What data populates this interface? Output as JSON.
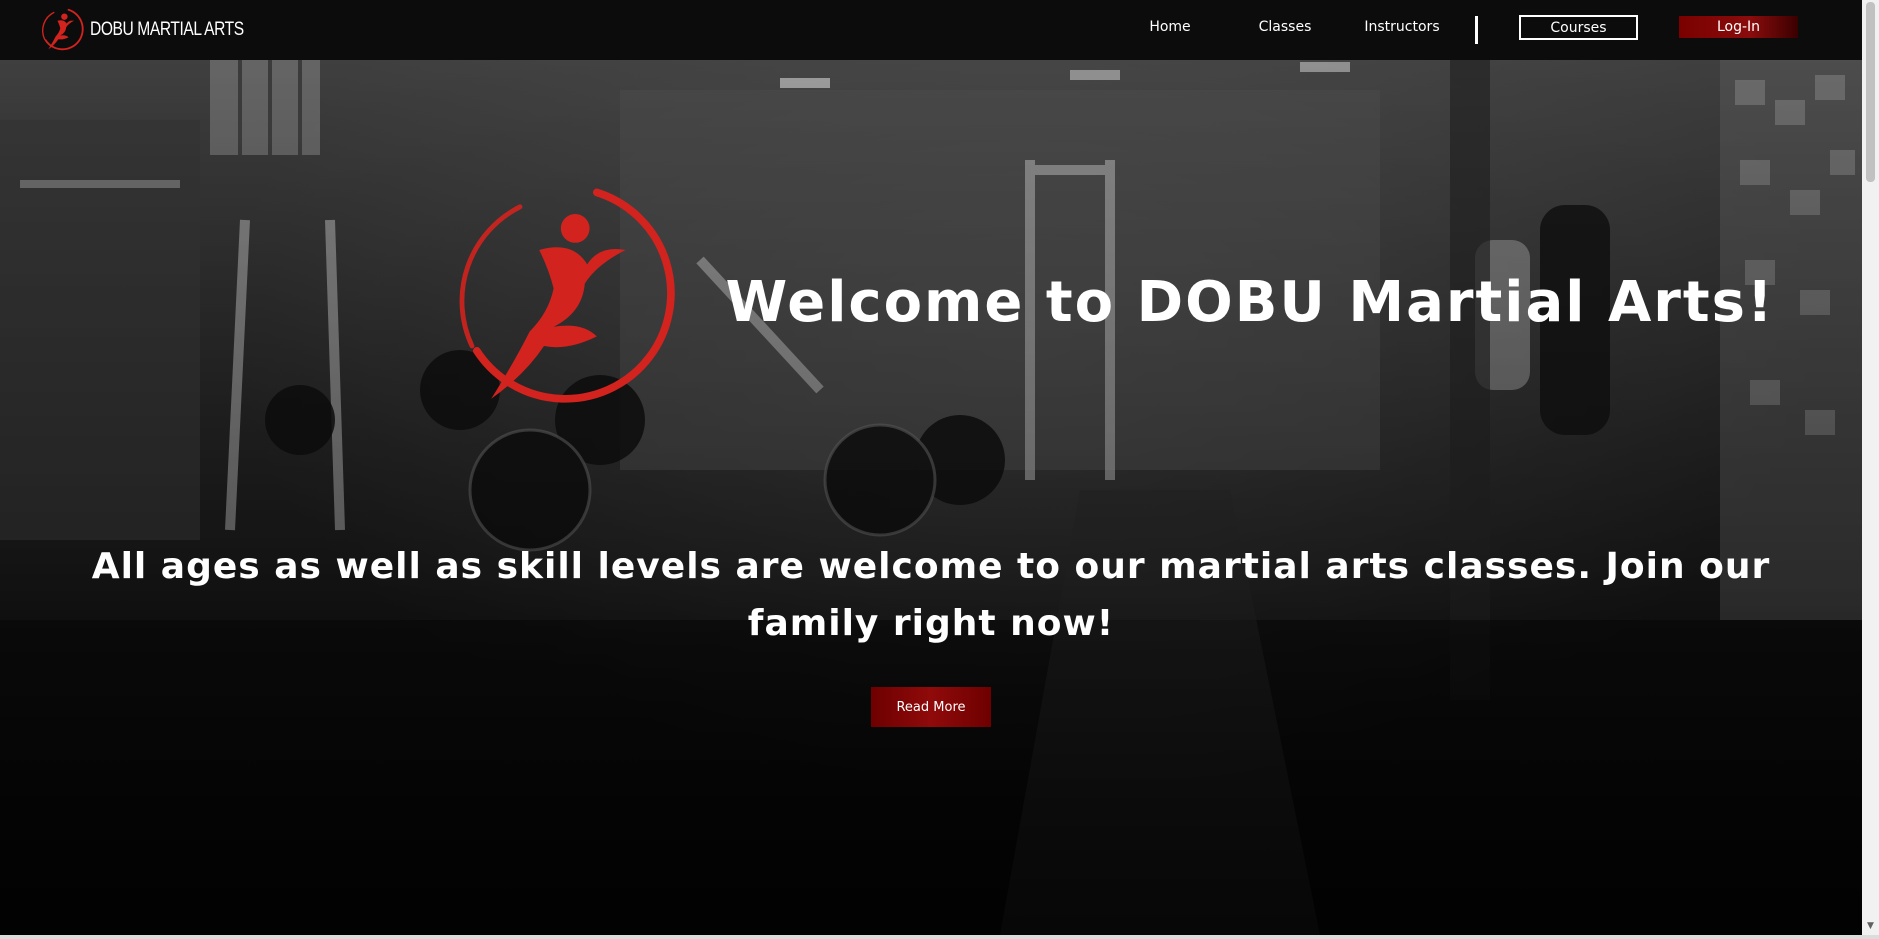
{
  "header": {
    "brand_name": "DOBU MARTIAL ARTS",
    "nav": {
      "home": "Home",
      "classes": "Classes",
      "instructors": "Instructors"
    },
    "courses_button": "Courses",
    "login_button": "Log-In"
  },
  "hero": {
    "title": "Welcome to DOBU Martial Arts!",
    "subtitle": "All ages as well as skill levels are welcome to our martial arts classes. Join our family right now!",
    "read_more_button": "Read More"
  },
  "colors": {
    "accent_red": "#d2231e",
    "button_red": "#8a0c0c",
    "navbar_bg": "#0c0c0c"
  },
  "icons": {
    "logo": "dobu-runner-logo-icon",
    "scroll_down": "chevron-down-icon"
  }
}
